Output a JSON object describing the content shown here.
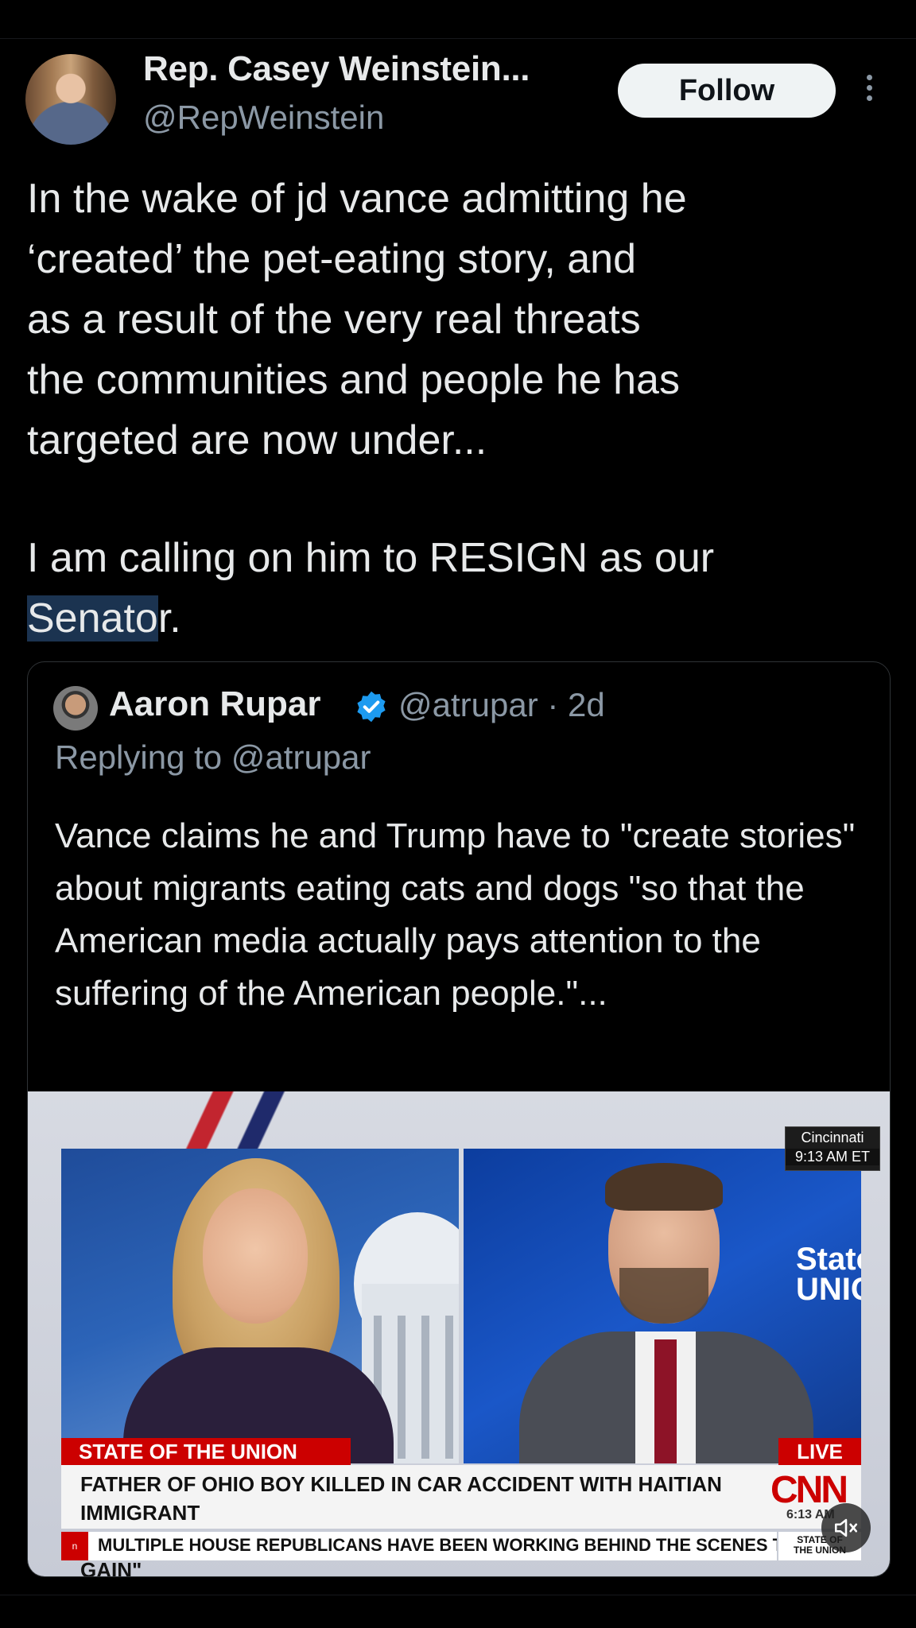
{
  "post": {
    "author_name": "Rep. Casey Weinstein...",
    "author_handle": "@RepWeinstein",
    "follow_label": "Follow",
    "text_part1": "In the wake of jd vance admitting he\n‘created’ the pet-eating story, and\nas a result of the very real threats\nthe communities and people he has\ntargeted are now under...",
    "text_part2_line1": "I am calling on him to RESIGN as our",
    "text_part2_highlight": "Senato",
    "text_part2_end": "r."
  },
  "quote": {
    "author_name": "Aaron Rupar",
    "meta": "@atrupar · 2d",
    "replying_to": "Replying to @atrupar",
    "text": "Vance claims he and Trump have to \"create stories\" about migrants eating cats and dogs \"so that the American media actually pays attention to the suffering of the American people.\"..."
  },
  "media": {
    "location": "Cincinnati",
    "location_time": "9:13 AM ET",
    "show_label": "STATE OF THE UNION",
    "live_label": "LIVE",
    "headline_line1": "FATHER OF OHIO BOY KILLED IN CAR ACCIDENT WITH HAITIAN IMMIGRANT",
    "headline_line2": "CALLS ON VANCE TO STOP USING SON'S DEATH FOR \"POLITICAL GAIN\"",
    "network_logo": "CNN",
    "network_time": "6:13 AM",
    "ticker": "MULTIPLE HOUSE REPUBLICANS HAVE BEEN WORKING BEHIND THE SCENES TO CC",
    "ticker_marker": "n",
    "sotu_small_line1": "STATE OF",
    "sotu_small_line2": "THE UNION",
    "state_logo_line1": "State",
    "state_logo_line2": "UNIC"
  },
  "icons": {
    "more": "more-vertical-icon",
    "verified": "verified-badge-icon",
    "mute": "speaker-muted-icon"
  },
  "colors": {
    "background": "#000000",
    "text": "#e7e9ea",
    "secondary_text": "#8b98a5",
    "verified": "#1d9bf0",
    "cnn_red": "#cc0000",
    "highlight": "#1b3350"
  }
}
